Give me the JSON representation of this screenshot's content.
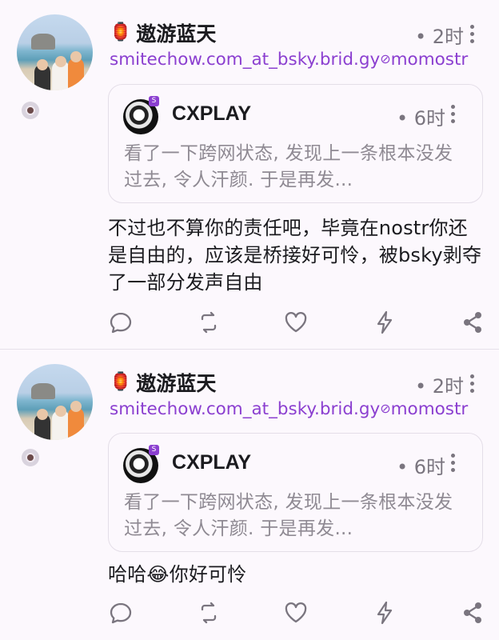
{
  "posts": [
    {
      "author": {
        "name": "遨游蓝天",
        "handle": "smitechow.com_at_bsky.brid.gy",
        "verified_mark": "⊘",
        "instance": "momostr",
        "lantern": "🏮"
      },
      "time": "• 2时",
      "quote": {
        "name": "CXPLAY",
        "time": "• 6时",
        "badge": "S",
        "text": "看了一下跨网状态, 发现上一条根本没发过去, 令人汗颜. 于是再发..."
      },
      "body": "不过也不算你的责任吧，毕竟在nostr你还是自由的，应该是桥接好可怜，被bsky剥夺了一部分发声自由"
    },
    {
      "author": {
        "name": "遨游蓝天",
        "handle": "smitechow.com_at_bsky.brid.gy",
        "verified_mark": "⊘",
        "instance": "momostr",
        "lantern": "🏮"
      },
      "time": "• 2时",
      "quote": {
        "name": "CXPLAY",
        "time": "• 6时",
        "badge": "S",
        "text": "看了一下跨网状态, 发现上一条根本没发过去, 令人汗颜. 于是再发..."
      },
      "body": "哈哈😂你好可怜"
    }
  ],
  "icons": [
    "reply-icon",
    "repost-icon",
    "like-icon",
    "zap-icon",
    "share-icon"
  ],
  "colors": {
    "accent": "#8b3fd0",
    "muted": "#7a757f",
    "background": "#fcf8fd"
  }
}
